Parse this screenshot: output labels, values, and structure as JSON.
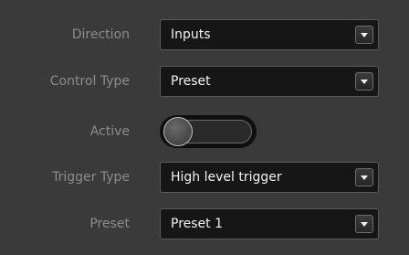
{
  "direction": {
    "label": "Direction",
    "value": "Inputs",
    "arrow_icon": "chevron-down-icon"
  },
  "control_type": {
    "label": "Control Type",
    "value": "Preset",
    "arrow_icon": "chevron-down-icon"
  },
  "active": {
    "label": "Active",
    "state": "off"
  },
  "trigger_type": {
    "label": "Trigger Type",
    "value": "High level trigger",
    "arrow_icon": "chevron-down-icon"
  },
  "preset": {
    "label": "Preset",
    "value": "Preset 1",
    "arrow_icon": "chevron-down-icon"
  },
  "colors": {
    "background": "#3a3a3a",
    "label_text": "#8c8c8c",
    "field_background": "#161616",
    "field_text": "#f2f2f2"
  }
}
